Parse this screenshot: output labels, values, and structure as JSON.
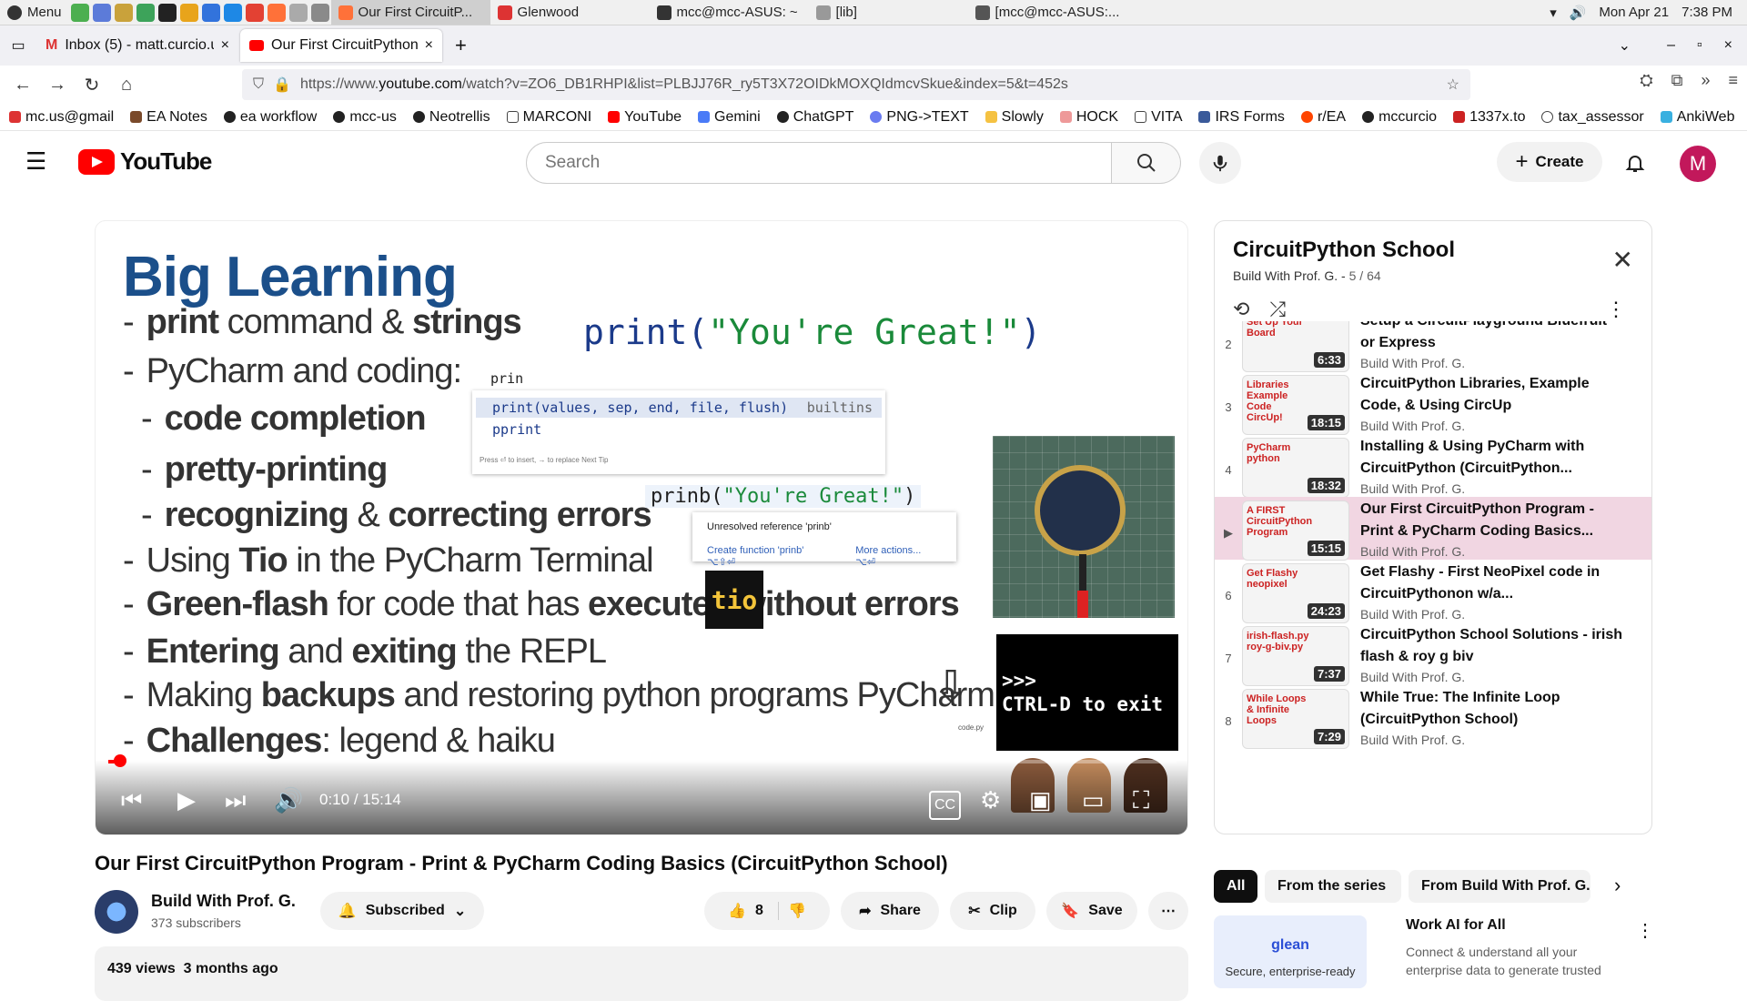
{
  "os": {
    "menu_label": "Menu",
    "tasks": [
      "Our First CircuitP...",
      "Glenwood",
      "mcc@mcc-ASUS: ~",
      "[lib]",
      "[mcc@mcc-ASUS:..."
    ],
    "date": "Mon Apr 21",
    "time": "7:38 PM"
  },
  "browser": {
    "tabs": [
      {
        "label": "Inbox (5) - matt.curcio.u",
        "icon": "gmail-icon"
      },
      {
        "label": "Our First CircuitPython",
        "icon": "youtube-icon"
      }
    ],
    "url_prefix": "https://www.",
    "url_host": "youtube.com",
    "url_path": "/watch?v=ZO6_DB1RHPI&list=PLBJJ76R_ry5T3X72OIDkMOXQIdmcvSkue&index=5&t=452s",
    "bookmarks": [
      "mc.us@gmail",
      "EA Notes",
      "ea workflow",
      "mcc-us",
      "Neotrellis",
      "MARCONI",
      "YouTube",
      "Gemini",
      "ChatGPT",
      "PNG->TEXT",
      "Slowly",
      "HOCK",
      "VITA",
      "IRS Forms",
      "r/EA",
      "mccurcio",
      "1337x.to",
      "tax_assessor",
      "AnkiWeb"
    ]
  },
  "youtube": {
    "logo_text": "YouTube",
    "search_placeholder": "Search",
    "create_label": "Create",
    "avatar_letter": "M"
  },
  "slide": {
    "title": "Big Learning",
    "big_print": "print(",
    "big_print_str": "\"You're Great!\"",
    "big_print_end": ")",
    "bullets": [
      {
        "pre": "-",
        "b1": "print",
        "t1": " command & ",
        "b2": "strings",
        "t2": ""
      },
      {
        "pre": "-",
        "b1": "",
        "t1": "PyCharm and coding:",
        "b2": "",
        "t2": ""
      },
      {
        "pre": "-",
        "b1": "code completion",
        "t1": "",
        "b2": "",
        "t2": ""
      },
      {
        "pre": "-",
        "b1": "pretty-printing",
        "t1": "",
        "b2": "",
        "t2": ""
      },
      {
        "pre": "-",
        "b1": "recognizing",
        "t1": " & ",
        "b2": "correcting errors",
        "t2": ""
      },
      {
        "pre": "-",
        "b1": "",
        "t1": "Using ",
        "b2": "Tio",
        "t2": " in the PyCharm Terminal"
      },
      {
        "pre": "-",
        "b1": "Green-flash",
        "t1": " for code that has ",
        "b2": "executed without errors",
        "t2": ""
      },
      {
        "pre": "-",
        "b1": "Entering",
        "t1": " and ",
        "b2": "exiting",
        "t2": " the REPL"
      },
      {
        "pre": "-",
        "b1": "",
        "t1": "Making ",
        "b2": "backups",
        "t2": " and restoring python programs PyCharm"
      },
      {
        "pre": "-",
        "b1": "Challenges",
        "t1": ": legend & haiku",
        "b2": "",
        "t2": ""
      }
    ],
    "ac_typed": "prin",
    "ac_row1": "print(values, sep, end, file, flush)",
    "ac_row1_src": "builtins",
    "ac_row2": "pprint",
    "ac_hint": "Press ⏎ to insert, → to replace  Next Tip",
    "prinb_code": "prinb(",
    "prinb_str": "\"You're Great!\"",
    "prinb_end": ")",
    "err_msg": "Unresolved reference 'prinb'",
    "err_act1": "Create function 'prinb'  ⌥⇧⏎",
    "err_act2": "More actions...  ⌥⏎",
    "tio_label": "tio",
    "repl_line1": ">>>",
    "repl_line2": "CTRL-D to exit",
    "dl_file": "code.py"
  },
  "player": {
    "current": "0:10",
    "duration": "15:14",
    "progress": 0.011
  },
  "video": {
    "title": "Our First CircuitPython Program - Print & PyCharm Coding Basics (CircuitPython School)",
    "channel": "Build With Prof. G.",
    "subscribers": "373 subscribers",
    "subscribed_label": "Subscribed",
    "likes": "8",
    "share_label": "Share",
    "clip_label": "Clip",
    "save_label": "Save",
    "views": "439 views",
    "age": "3 months ago"
  },
  "playlist": {
    "title": "CircuitPython School",
    "channel": "Build With Prof. G.",
    "position": "5 / 64",
    "items": [
      {
        "idx": "2",
        "title": "Setup a CircuitPlayground Bluefruit or Express",
        "channel": "Build With Prof. G.",
        "duration": "6:33",
        "thumb": "Set Up Your Board"
      },
      {
        "idx": "3",
        "title": "CircuitPython Libraries, Example Code, & Using CircUp",
        "channel": "Build With Prof. G.",
        "duration": "18:15",
        "thumb": "Libraries Example Code CircUp!"
      },
      {
        "idx": "4",
        "title": "Installing & Using PyCharm with CircuitPython (CircuitPython...",
        "channel": "Build With Prof. G.",
        "duration": "18:32",
        "thumb": "PyCharm python"
      },
      {
        "idx": "▶",
        "title": "Our First CircuitPython Program - Print & PyCharm Coding Basics...",
        "channel": "Build With Prof. G.",
        "duration": "15:15",
        "thumb": "A FIRST CircuitPython Program"
      },
      {
        "idx": "6",
        "title": "Get Flashy - First NeoPixel code in CircuitPythonon w/a...",
        "channel": "Build With Prof. G.",
        "duration": "24:23",
        "thumb": "Get Flashy neopixel"
      },
      {
        "idx": "7",
        "title": "CircuitPython School Solutions - irish flash & roy g biv",
        "channel": "Build With Prof. G.",
        "duration": "7:37",
        "thumb": "irish-flash.py roy-g-biv.py"
      },
      {
        "idx": "8",
        "title": "While True: The Infinite Loop (CircuitPython School)",
        "channel": "Build With Prof. G.",
        "duration": "7:29",
        "thumb": "While Loops & Infinite Loops"
      }
    ]
  },
  "chips": [
    "All",
    "From the series",
    "From Build With Prof. G."
  ],
  "ad": {
    "logo": "glean",
    "tagline": "Secure, enterprise-ready",
    "title": "Work AI for All",
    "desc": "Connect & understand all your enterprise data to generate trusted"
  }
}
